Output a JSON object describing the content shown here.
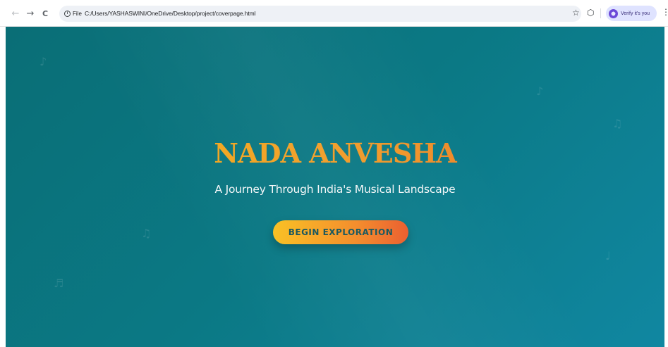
{
  "browser": {
    "back_icon": "←",
    "forward_icon": "→",
    "reload_icon": "C",
    "site_info_label": "File",
    "url": "C:/Users/YASHASWINI/OneDrive/Desktop/project/coverpage.html",
    "bookmark_icon": "☆",
    "extensions_icon": "⬡",
    "verify_label": "Verify it's you",
    "menu_icon": "⋮"
  },
  "page": {
    "title": "NADA ANVESHA",
    "subtitle": "A Journey Through India's Musical Landscape",
    "cta_label": "BEGIN EXPLORATION",
    "notes": [
      "♪",
      "♪",
      "♫",
      "♫",
      "♬",
      "♩"
    ]
  },
  "colors": {
    "background_start": "#0a6e76",
    "background_end": "#1087a1",
    "title_gradient_start": "#f5b915",
    "title_gradient_end": "#e8602a",
    "button_gradient_start": "#f9c021",
    "button_gradient_end": "#ea5b2b",
    "button_text": "#14545a",
    "subtitle_text": "#f4f7f8"
  }
}
